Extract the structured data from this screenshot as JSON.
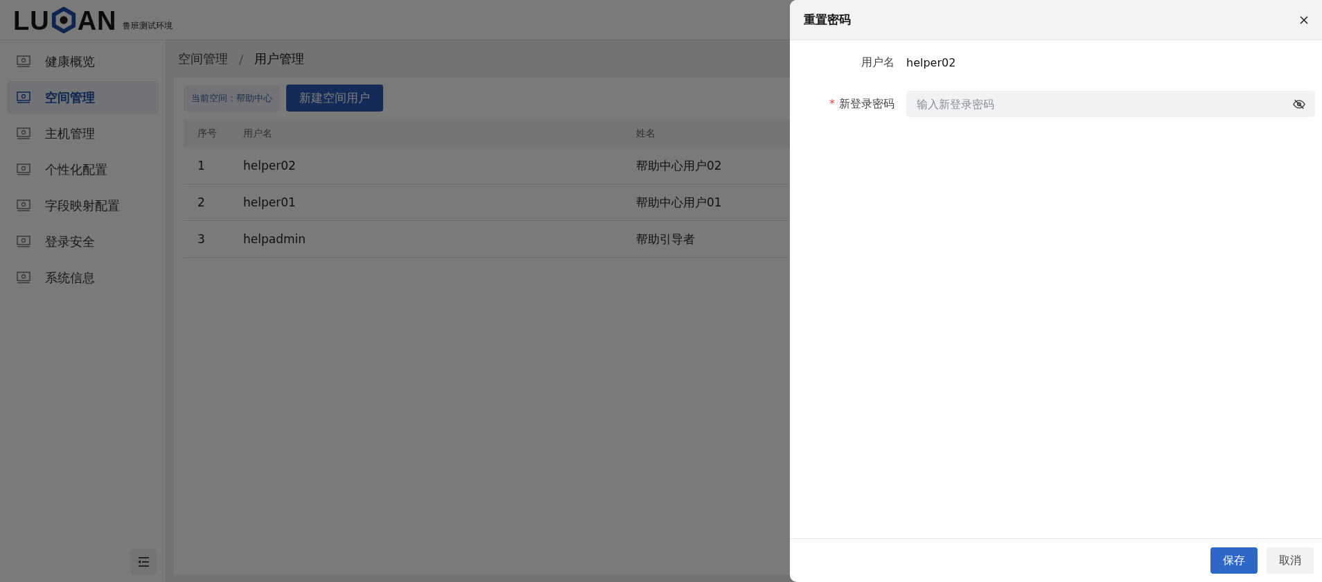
{
  "header": {
    "logo_left": "LU",
    "logo_right": "AN",
    "environment": "鲁班测试环境"
  },
  "sidebar": {
    "items": [
      {
        "label": "健康概览",
        "selected": false
      },
      {
        "label": "空间管理",
        "selected": true
      },
      {
        "label": "主机管理",
        "selected": false
      },
      {
        "label": "个性化配置",
        "selected": false
      },
      {
        "label": "字段映射配置",
        "selected": false
      },
      {
        "label": "登录安全",
        "selected": false
      },
      {
        "label": "系统信息",
        "selected": false
      }
    ]
  },
  "breadcrumb": {
    "items": [
      "空间管理",
      "用户管理"
    ],
    "separator": "/"
  },
  "toolbar": {
    "space_tag": "当前空间：帮助中心",
    "new_button": "新建空间用户"
  },
  "table": {
    "columns": [
      "序号",
      "用户名",
      "姓名"
    ],
    "rows": [
      [
        "1",
        "helper02",
        "帮助中心用户02"
      ],
      [
        "2",
        "helper01",
        "帮助中心用户01"
      ],
      [
        "3",
        "helpadmin",
        "帮助引导者"
      ]
    ]
  },
  "drawer": {
    "title": "重置密码",
    "fields": [
      {
        "kind": "text",
        "label": "用户名",
        "value": "helper02"
      },
      {
        "kind": "password",
        "label": "新登录密码",
        "required_mark": "*",
        "placeholder": "输入新登录密码"
      }
    ],
    "buttons": [
      {
        "label": "保存",
        "kind": "primary"
      },
      {
        "label": "取消",
        "kind": "default"
      }
    ]
  }
}
